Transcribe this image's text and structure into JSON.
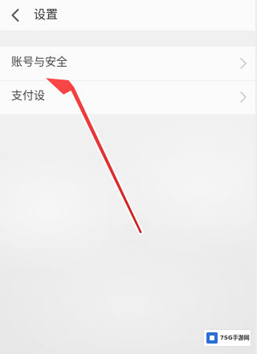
{
  "header": {
    "title": "设置"
  },
  "settings": {
    "items": [
      {
        "label": "账号与安全"
      },
      {
        "label": "支付设"
      }
    ]
  },
  "watermark": {
    "text": "7SG手游网"
  },
  "colors": {
    "arrow": "#e53935",
    "header_bg": "#fbfbfb",
    "page_bg": "#ececec",
    "watermark_accent": "#2a6fd6"
  },
  "icons": {
    "back": "chevron-left-icon",
    "row": "chevron-right-icon"
  }
}
